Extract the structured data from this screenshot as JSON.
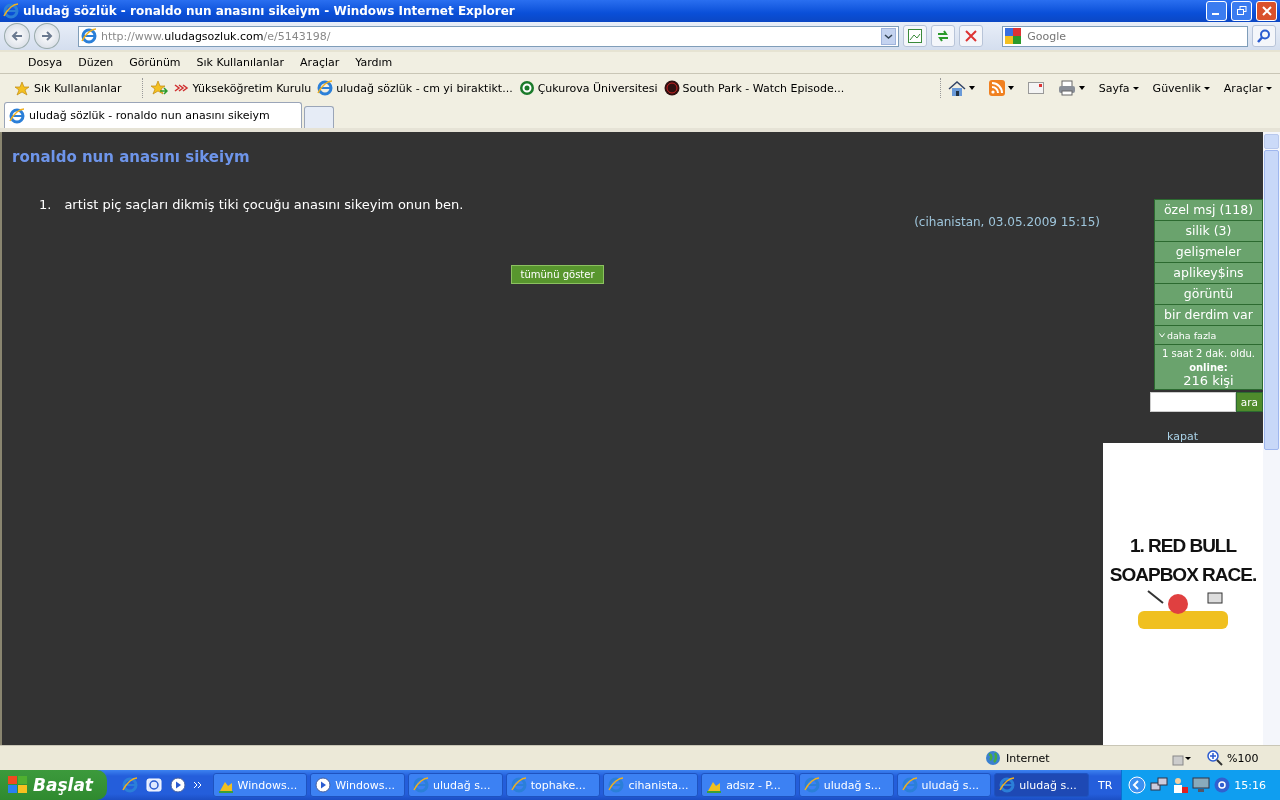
{
  "window": {
    "title": "uludağ sözlük - ronaldo nun anasını sikeiym - Windows Internet Explorer"
  },
  "address": {
    "url_prefix": "http://www.",
    "url_domain": "uludagsozluk.com",
    "url_path": "/e/5143198/"
  },
  "search": {
    "placeholder": "Google"
  },
  "menu": [
    "Dosya",
    "Düzen",
    "Görünüm",
    "Sık Kullanılanlar",
    "Araçlar",
    "Yardım"
  ],
  "favorites": {
    "label": "Sık Kullanılanlar",
    "links": [
      {
        "kind": "yok",
        "label": "Yükseköğretim Kurulu"
      },
      {
        "kind": "ie",
        "label": "uludağ sözlük - cm yi biraktikt..."
      },
      {
        "kind": "cukurova",
        "label": "Çukurova Üniversitesi"
      },
      {
        "kind": "sp",
        "label": "South Park - Watch Episode..."
      }
    ]
  },
  "commands": [
    {
      "kind": "home"
    },
    {
      "kind": "feed"
    },
    {
      "kind": "mail"
    },
    {
      "kind": "print"
    },
    {
      "kind": "menu",
      "label": "Sayfa"
    },
    {
      "kind": "menu",
      "label": "Güvenlik"
    },
    {
      "kind": "menu",
      "label": "Araçlar"
    }
  ],
  "tabs": [
    {
      "label": "uludağ sözlük - ronaldo nun anasını sikeiym",
      "selected": true
    }
  ],
  "page": {
    "heading": "ronaldo nun anasını sikeiym",
    "entries": [
      {
        "number": "1.",
        "text": "artist piç saçları dikmiş tiki çocuğu anasını sikeyim onun ben.",
        "byline": "(cihanistan, 03.05.2009 15:15)"
      }
    ],
    "show_all_button": "tümünü göster",
    "sidebar": {
      "items": [
        "özel msj (118)",
        "silik (3)",
        "gelişmeler",
        "aplikey$ins",
        "görüntü",
        "bir derdim var"
      ],
      "more": "daha fazla",
      "uptime": "1 saat 2 dak. oldu.",
      "online_label": "online:",
      "online_count": "216 kişi",
      "search_button": "ara"
    },
    "close_link": "kapat",
    "ad": {
      "lines": [
        "1. RED BULL",
        "SOAPBOX RACE."
      ]
    }
  },
  "status_bar": {
    "zone": "Internet",
    "zoom": "%100"
  },
  "taskbar": {
    "start": "Başlat",
    "quick_launch": [
      {
        "kind": "ie"
      },
      {
        "kind": "outlook"
      },
      {
        "kind": "media"
      }
    ],
    "tasks": [
      {
        "kind": "paint",
        "label": "Windows...",
        "selected": false
      },
      {
        "kind": "media",
        "label": "Windows...",
        "selected": false
      },
      {
        "kind": "ie",
        "label": "uludağ s...",
        "selected": false
      },
      {
        "kind": "ie",
        "label": "tophake...",
        "selected": false
      },
      {
        "kind": "ie",
        "label": "cihanista...",
        "selected": false
      },
      {
        "kind": "paint",
        "label": "adsız - P...",
        "selected": false
      },
      {
        "kind": "ie",
        "label": "uludağ s...",
        "selected": false
      },
      {
        "kind": "ie",
        "label": "uludağ s...",
        "selected": false
      },
      {
        "kind": "ie",
        "label": "uludağ s...",
        "selected": true
      }
    ],
    "language": "TR",
    "clock": "15:16"
  }
}
